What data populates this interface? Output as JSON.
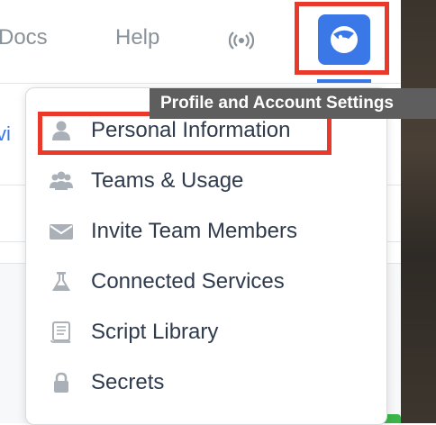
{
  "nav": {
    "docs": "Docs",
    "help": "Help",
    "broadcast_icon": "broadcast-icon",
    "avatar_icon": "profile-avatar-icon",
    "accent_color": "#3b78e7"
  },
  "tooltip": "Profile and Account Settings",
  "background": {
    "partial_link": "vi"
  },
  "menu": {
    "items": [
      {
        "label": "Personal Information",
        "icon": "person-icon"
      },
      {
        "label": "Teams & Usage",
        "icon": "users-icon"
      },
      {
        "label": "Invite Team Members",
        "icon": "envelope-icon"
      },
      {
        "label": "Connected Services",
        "icon": "flask-icon"
      },
      {
        "label": "Script Library",
        "icon": "scroll-icon"
      },
      {
        "label": "Secrets",
        "icon": "lock-icon"
      }
    ]
  },
  "highlight_color": "#e8392b"
}
